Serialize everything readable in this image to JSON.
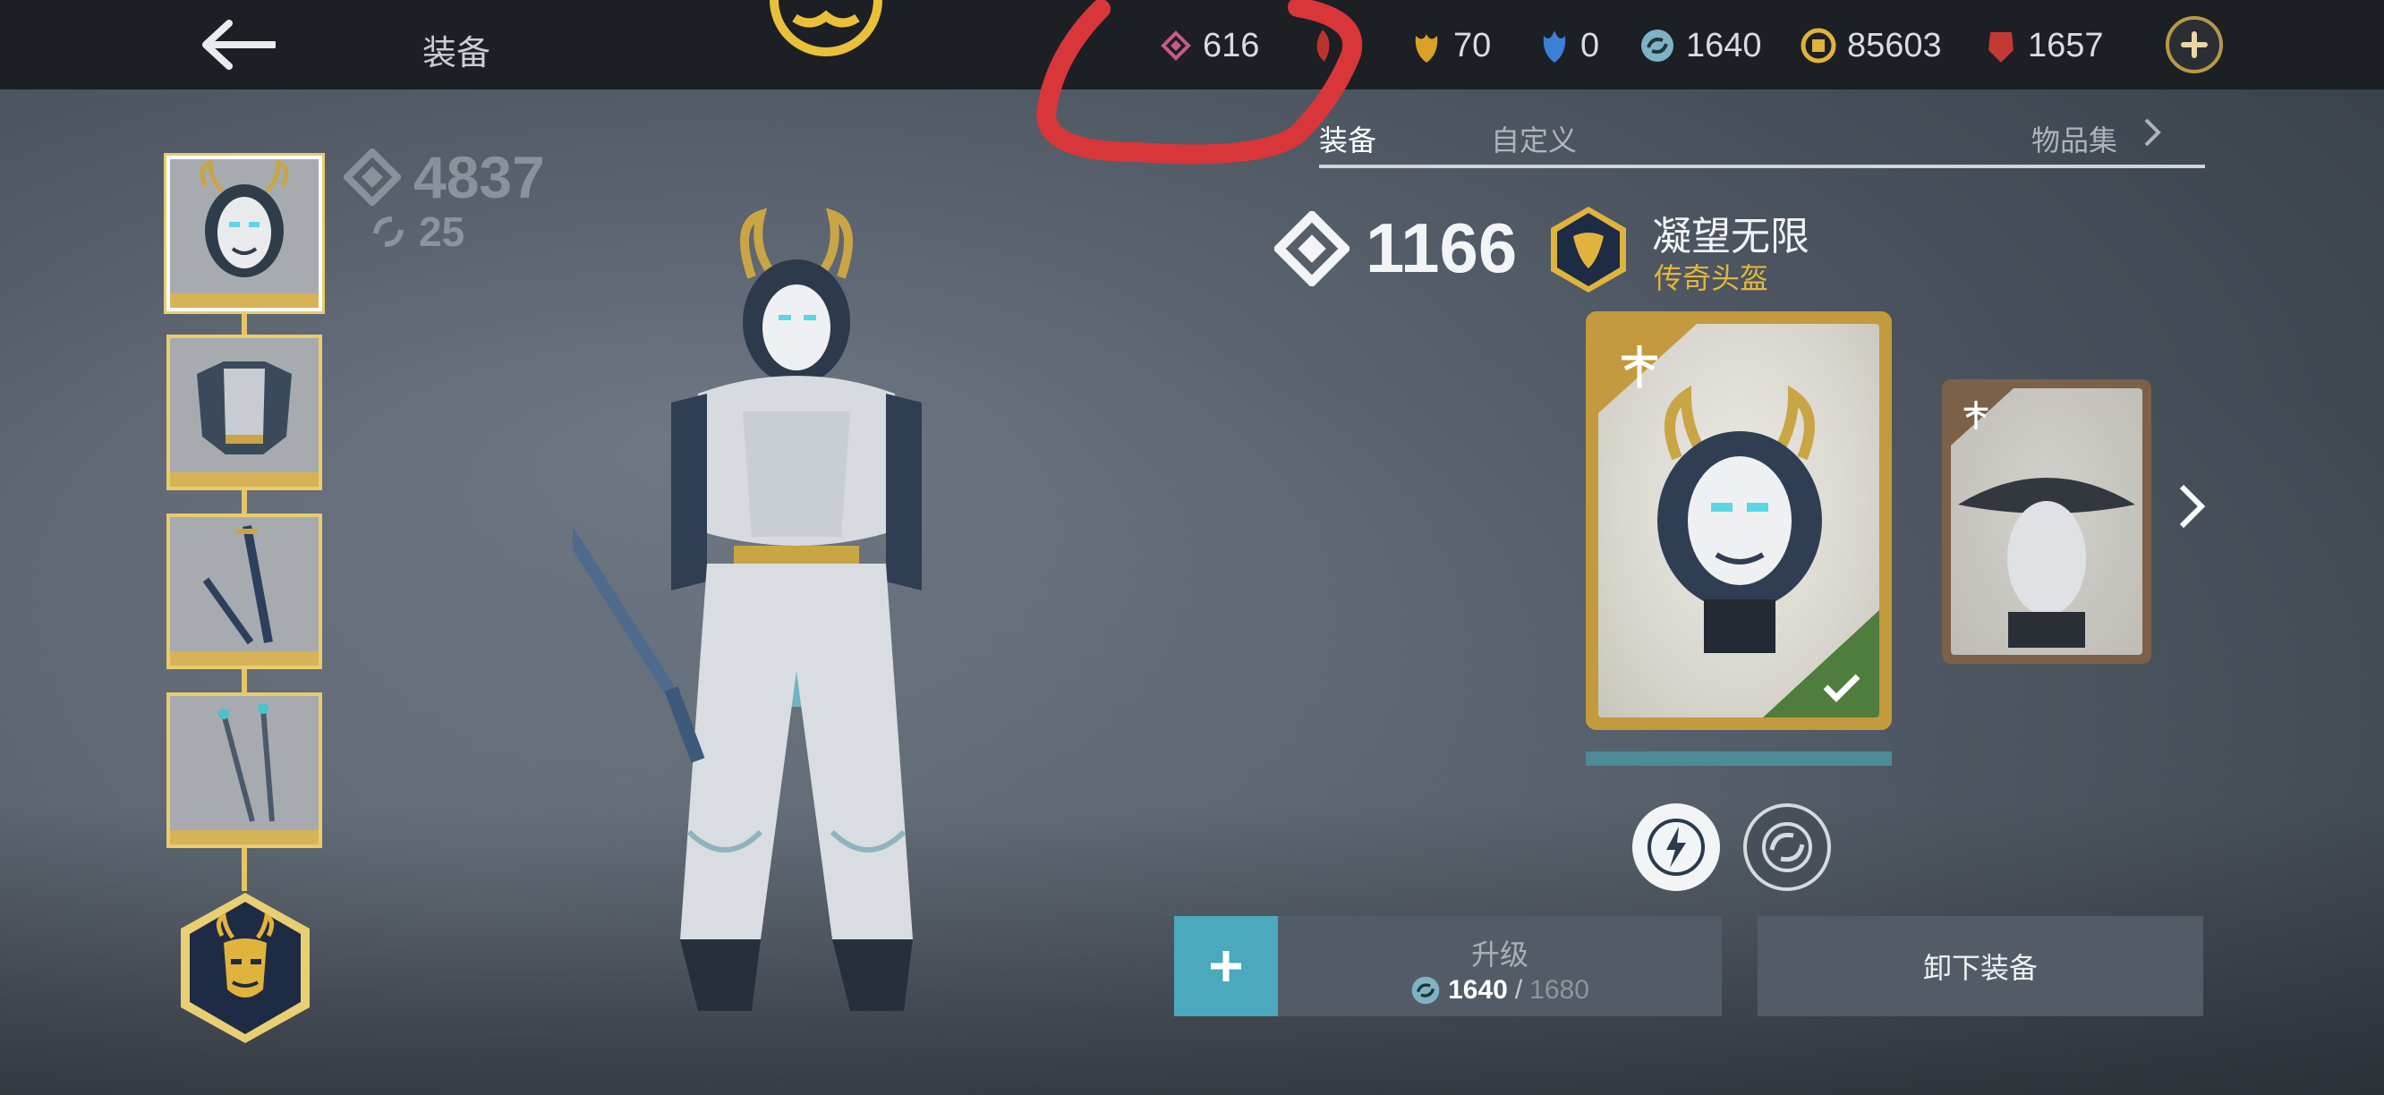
{
  "header": {
    "title": "装备",
    "resources": [
      {
        "name": "gem-pink",
        "value": "616",
        "color": "#c85a8a"
      },
      {
        "name": "leaf-gold",
        "value": "70",
        "color": "#d9a227"
      },
      {
        "name": "crystal-blue",
        "value": "0",
        "color": "#3b7fd6"
      },
      {
        "name": "swirl-teal",
        "value": "1640",
        "color": "#7fb3c4"
      },
      {
        "name": "coin-gold",
        "value": "85603",
        "color": "#e0b43c"
      },
      {
        "name": "ruby-red",
        "value": "1657",
        "color": "#c23a33"
      }
    ]
  },
  "left": {
    "total_power": "4837",
    "level": "25"
  },
  "tabs": {
    "equip": "装备",
    "custom": "自定义",
    "collection": "物品集"
  },
  "item": {
    "power": "1166",
    "name": "凝望无限",
    "type": "传奇头盔"
  },
  "upgrade": {
    "label": "升级",
    "current": "1640",
    "separator": "/",
    "required": "1680"
  },
  "unequip_label": "卸下装备",
  "colors": {
    "accent_gold": "#d8b256",
    "accent_teal": "#4aa9bd",
    "legendary_text": "#e2b63f",
    "equipped_green": "#4f7d3d"
  }
}
